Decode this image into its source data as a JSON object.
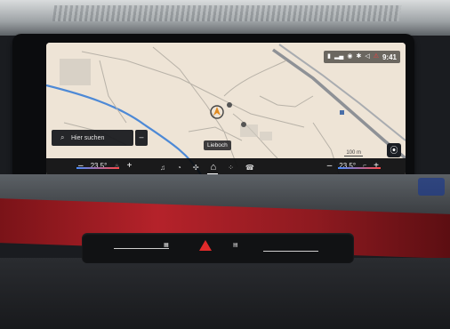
{
  "status_bar": {
    "icons": [
      "status-battery-icon",
      "signal-icon",
      "network-icon",
      "bluetooth-icon",
      "navigation-icon",
      "warning-icon"
    ],
    "time": "9:41"
  },
  "map": {
    "search_placeholder": "Hier suchen",
    "collapse_label": "–",
    "place_label": "Lieboch",
    "scale": "100 m"
  },
  "climate": {
    "left_temp": "23.5°",
    "right_temp": "23.5°",
    "minus": "–",
    "plus": "+"
  },
  "dock_icons": [
    "music-icon",
    "phone-icon",
    "fan-icon",
    "home-icon",
    "apps-icon",
    "call-icon"
  ],
  "colors": {
    "temp_cold": "#4a8dff",
    "temp_hot": "#ff4a4a",
    "hazard": "#e02a2a",
    "trim_red": "#b5222a"
  }
}
